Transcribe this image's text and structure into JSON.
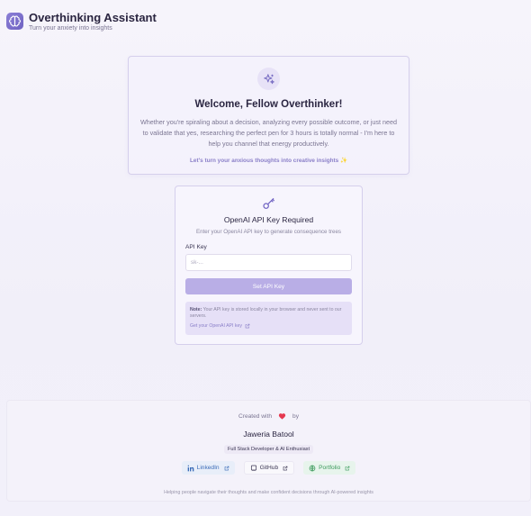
{
  "header": {
    "title": "Overthinking Assistant",
    "subtitle": "Turn your anxiety into insights"
  },
  "welcome": {
    "title": "Welcome, Fellow Overthinker!",
    "body": "Whether you're spiraling about a decision, analyzing every possible outcome, or just need to validate that yes, researching the perfect pen for 3 hours is totally normal - I'm here to help you channel that energy productively.",
    "cta": "Let's turn your anxious thoughts into creative insights ✨"
  },
  "api_card": {
    "title": "OpenAI API Key Required",
    "description": "Enter your OpenAI API key to generate consequence trees",
    "field_label": "API Key",
    "field_value": "",
    "field_placeholder": "sk-...",
    "button_label": "Set API Key",
    "note_label": "Note:",
    "note_text": " Your API key is stored locally in your browser and never sent to our servers.",
    "note_link": "Get your OpenAI API key"
  },
  "footer": {
    "created_with": "Created with",
    "by": "by",
    "author": "Jaweria Batool",
    "role": "Full Stack Developer & AI Enthusiast",
    "links": {
      "linkedin": "LinkedIn",
      "github": "GitHub",
      "portfolio": "Portfolio"
    },
    "tagline": "Helping people navigate their thoughts and make confident decisions through AI-powered insights"
  },
  "colors": {
    "accent": "#8b7fd6",
    "button": "#b9aee6",
    "linkedin": "#3b6cb8",
    "portfolio": "#3c9a5c",
    "heart": "#e53950"
  },
  "icons": [
    "brain-icon",
    "sparkles-icon",
    "key-icon",
    "external-link-icon",
    "heart-icon",
    "linkedin-icon",
    "github-icon",
    "globe-icon"
  ]
}
